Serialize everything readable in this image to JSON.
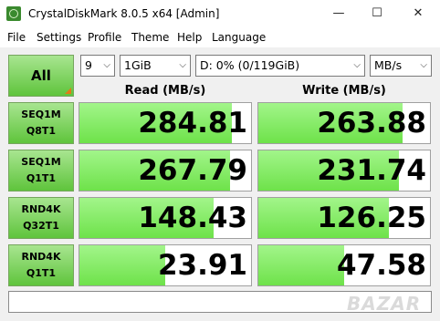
{
  "window": {
    "title": "CrystalDiskMark 8.0.5 x64 [Admin]",
    "minimize": "—",
    "maximize": "☐",
    "close": "✕"
  },
  "menu": [
    "File",
    "Settings",
    "Profile",
    "Theme",
    "Help",
    "Language"
  ],
  "controls": {
    "all_label": "All",
    "count": "9",
    "size": "1GiB",
    "drive": "D: 0% (0/119GiB)",
    "unit": "MB/s"
  },
  "headers": {
    "read": "Read (MB/s)",
    "write": "Write (MB/s)"
  },
  "tests": [
    {
      "line1": "SEQ1M",
      "line2": "Q8T1",
      "read": "284.81",
      "write": "263.88"
    },
    {
      "line1": "SEQ1M",
      "line2": "Q1T1",
      "read": "267.79",
      "write": "231.74"
    },
    {
      "line1": "RND4K",
      "line2": "Q32T1",
      "read": "148.43",
      "write": "126.25"
    },
    {
      "line1": "RND4K",
      "line2": "Q1T1",
      "read": "23.91",
      "write": "47.58"
    }
  ],
  "comment": "",
  "watermark": "BAZAR",
  "colors": {
    "button_green": "#5fc43c",
    "bar_green": "#6ee24a",
    "accent_orange": "#e07b18"
  }
}
